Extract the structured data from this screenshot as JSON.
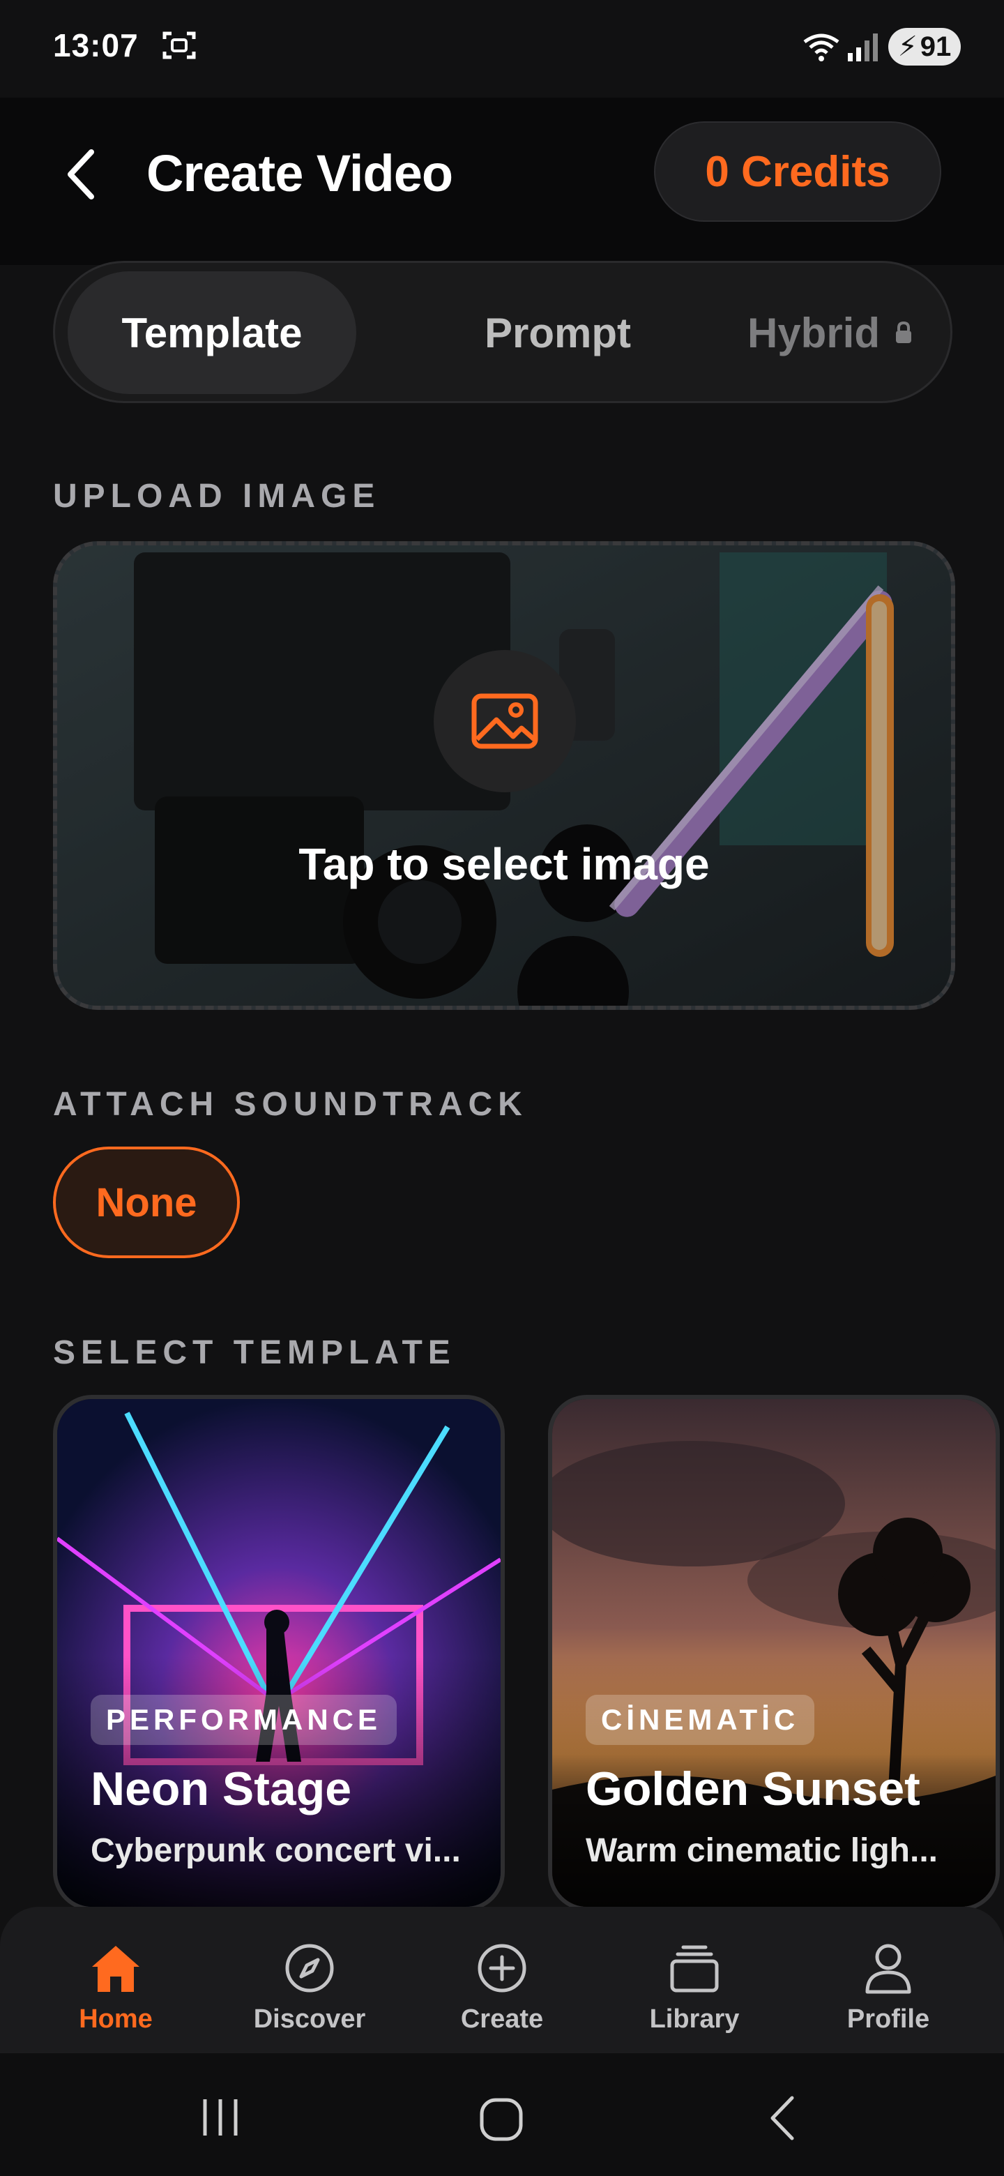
{
  "status_bar": {
    "time": "13:07",
    "battery": "91"
  },
  "header": {
    "title": "Create Video",
    "credits": "0 Credits"
  },
  "segments": [
    {
      "label": "Template",
      "active": true
    },
    {
      "label": "Prompt",
      "active": false
    },
    {
      "label": "Hybrid",
      "active": false,
      "locked": true
    }
  ],
  "upload": {
    "section_label": "UPLOAD IMAGE",
    "cta": "Tap to select image",
    "icon": "image-icon"
  },
  "soundtrack": {
    "section_label": "ATTACH SOUNDTRACK",
    "selected": "None"
  },
  "templates": {
    "section_label": "SELECT TEMPLATE",
    "items": [
      {
        "badge": "PERFORMANCE",
        "title": "Neon Stage",
        "subtitle": "Cyberpunk concert vi..."
      },
      {
        "badge": "CİNEMATİC",
        "title": "Golden Sunset",
        "subtitle": "Warm cinematic ligh..."
      }
    ]
  },
  "bottom_nav": [
    {
      "label": "Home",
      "icon": "home-icon",
      "active": true
    },
    {
      "label": "Discover",
      "icon": "compass-icon",
      "active": false
    },
    {
      "label": "Create",
      "icon": "plus-circle-icon",
      "active": false
    },
    {
      "label": "Library",
      "icon": "stack-icon",
      "active": false
    },
    {
      "label": "Profile",
      "icon": "user-icon",
      "active": false
    }
  ],
  "colors": {
    "accent": "#ff6a1f",
    "background": "#111112"
  }
}
